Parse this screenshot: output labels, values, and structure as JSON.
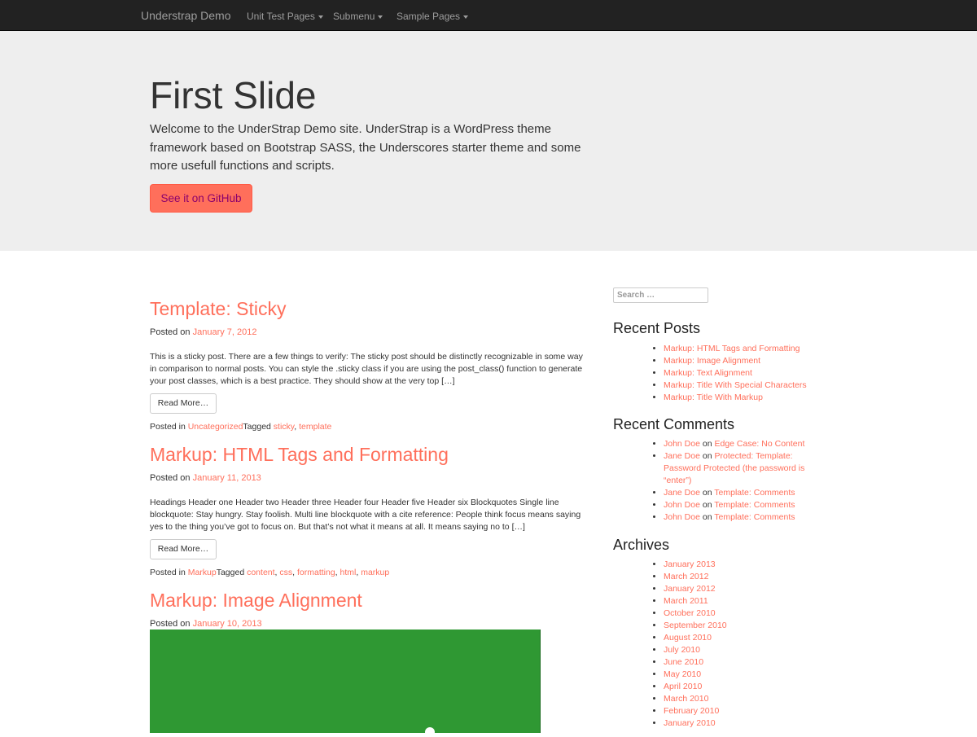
{
  "navbar": {
    "brand": "Understrap Demo",
    "items": [
      {
        "label": "Unit Test Pages"
      },
      {
        "label": "Submenu"
      },
      {
        "label": "Sample Pages"
      }
    ]
  },
  "hero": {
    "title": "First Slide",
    "text": "Welcome to the UnderStrap Demo site. UnderStrap is a WordPress theme framework based on Bootstrap SASS, the Underscores starter theme and some more usefull functions and scripts.",
    "button_label": "See it on GitHub"
  },
  "posts": [
    {
      "title": "Template: Sticky",
      "posted_on_label": "Posted on",
      "date": "January 7, 2012",
      "excerpt": "This is a sticky post. There are a few things to verify: The sticky post should be distinctly recognizable in some way in comparison to normal posts. You can style the .sticky class if you are using the post_class() function to generate your post classes, which is a best practice. They should show at the very top […]",
      "read_more": "Read More…",
      "posted_in_label": "Posted in",
      "category": "Uncategorized",
      "tagged_label": "Tagged",
      "tags": [
        "sticky",
        "template"
      ]
    },
    {
      "title": "Markup: HTML Tags and Formatting",
      "posted_on_label": "Posted on",
      "date": "January 11, 2013",
      "excerpt": "Headings Header one Header two Header three Header four Header five Header six Blockquotes Single line blockquote: Stay hungry. Stay foolish. Multi line blockquote with a cite reference: People think focus means saying yes to the thing you’ve got to focus on. But that’s not what it means at all. It means saying no to […]",
      "read_more": "Read More…",
      "posted_in_label": "Posted in",
      "category": "Markup",
      "tagged_label": "Tagged",
      "tags": [
        "content",
        "css",
        "formatting",
        "html",
        "markup"
      ]
    },
    {
      "title": "Markup: Image Alignment",
      "posted_on_label": "Posted on",
      "date": "January 10, 2013"
    }
  ],
  "sidebar": {
    "search_placeholder": "Search …",
    "recent_posts": {
      "title": "Recent Posts",
      "items": [
        "Markup: HTML Tags and Formatting",
        "Markup: Image Alignment",
        "Markup: Text Alignment",
        "Markup: Title With Special Characters",
        "Markup: Title With Markup"
      ]
    },
    "recent_comments": {
      "title": "Recent Comments",
      "connector": "on",
      "items": [
        {
          "author": "John Doe",
          "post": "Edge Case: No Content"
        },
        {
          "author": "Jane Doe",
          "post": "Protected: Template: Password Protected (the password is “enter”)"
        },
        {
          "author": "Jane Doe",
          "post": "Template: Comments"
        },
        {
          "author": "John Doe",
          "post": "Template: Comments"
        },
        {
          "author": "John Doe",
          "post": "Template: Comments"
        }
      ]
    },
    "archives": {
      "title": "Archives",
      "items": [
        "January 2013",
        "March 2012",
        "January 2012",
        "March 2011",
        "October 2010",
        "September 2010",
        "August 2010",
        "July 2010",
        "June 2010",
        "May 2010",
        "April 2010",
        "March 2010",
        "February 2010",
        "January 2010"
      ]
    }
  },
  "colors": {
    "navbar_bg": "#222222",
    "hero_bg": "#eeeeee",
    "accent": "#ff6f5b",
    "image_green": "#2f9833"
  },
  "icons": [
    "caret-down-icon"
  ]
}
